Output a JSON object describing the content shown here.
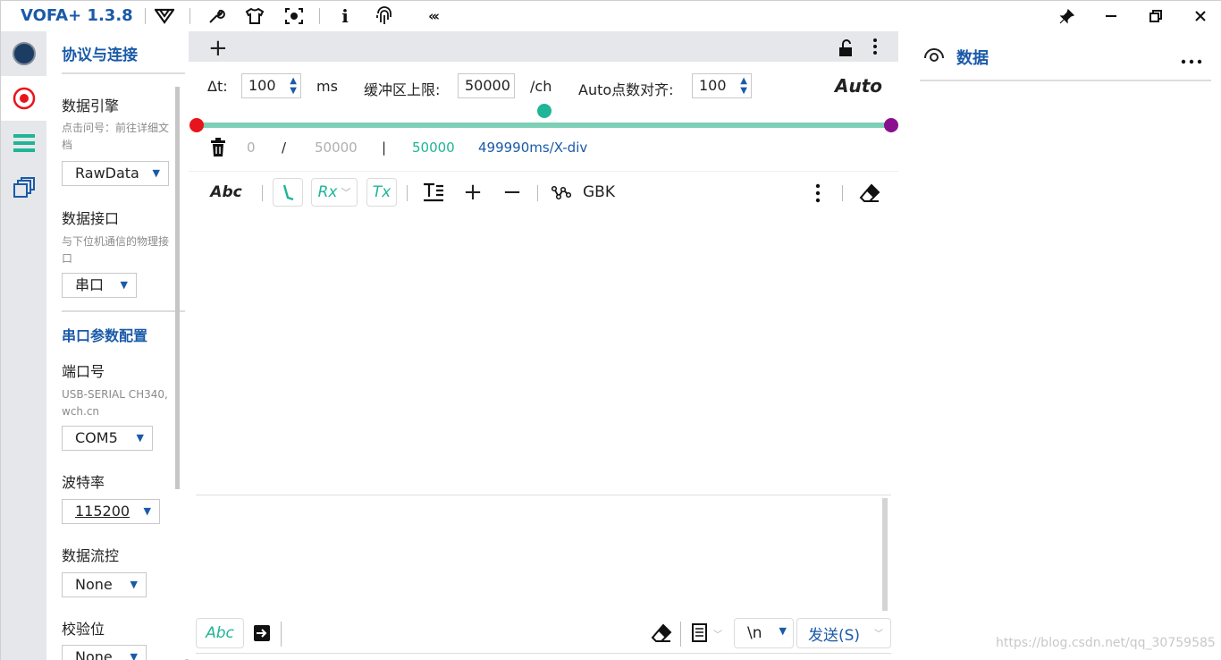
{
  "window": {
    "title": "VOFA+ 1.3.8"
  },
  "titlebar": {
    "icons": [
      "logo-v-icon",
      "wrench-icon",
      "tshirt-icon",
      "capture-icon",
      "info-icon",
      "fingerprint-icon",
      "collapse-icon"
    ],
    "window_buttons": [
      "pin-icon",
      "minimize-icon",
      "restore-icon",
      "close-icon"
    ]
  },
  "rail": {
    "items": [
      "connection-icon",
      "record-icon",
      "list-icon",
      "windows-icon"
    ]
  },
  "left_panel": {
    "title": "协议与连接",
    "engine_label": "数据引擎",
    "engine_hint": "点击问号：前往详细文档",
    "engine_value": "RawData",
    "interface_label": "数据接口",
    "interface_hint": "与下位机通信的物理接口",
    "interface_value": "串口",
    "serial_title": "串口参数配置",
    "port_label": "端口号",
    "port_hint": "USB-SERIAL CH340, wch.cn",
    "port_value": "COM5",
    "baud_label": "波特率",
    "baud_value": "115200",
    "flow_label": "数据流控",
    "flow_value": "None",
    "parity_label": "校验位",
    "parity_value": "None"
  },
  "controls": {
    "dt_label": "Δt:",
    "dt_value": "100",
    "dt_unit": "ms",
    "buffer_label": "缓冲区上限:",
    "buffer_value": "50000",
    "buffer_unit": "/ch",
    "align_label": "Auto点数对齐:",
    "align_value": "100",
    "auto_label": "Auto",
    "stat_count": "0",
    "stat_slash": "/",
    "stat_total": "50000",
    "stat_bar": "|",
    "stat_window": "50000",
    "stat_xdiv": "499990ms/X-div",
    "slider_left_color": "#e8141b",
    "slider_mid_color": "#1fb597",
    "slider_right_color": "#8a0f8f"
  },
  "text_toolbar": {
    "abc": "Abc",
    "rx": "Rx",
    "tx": "Tx",
    "encoding": "GBK"
  },
  "send_bar": {
    "abc": "Abc",
    "newline": "\\n",
    "send": "发送(S)"
  },
  "right_panel": {
    "title": "数据"
  },
  "watermark": "https://blog.csdn.net/qq_30759585"
}
